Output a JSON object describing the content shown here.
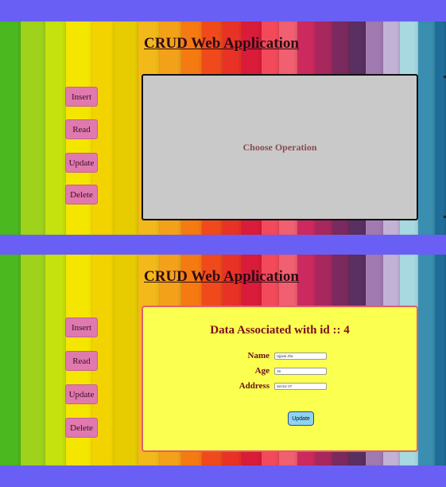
{
  "app_title": "CRUD Web Application",
  "menu": [
    "Insert",
    "Read",
    "Update",
    "Delete"
  ],
  "view1": {
    "message": "Choose Operation"
  },
  "view2": {
    "heading": "Data Associated with id :: 4",
    "fields": [
      {
        "label": "Name",
        "value": "Ujjwal Jha"
      },
      {
        "label": "Age",
        "value": "16"
      },
      {
        "label": "Address",
        "value": "Sector 07"
      }
    ],
    "update_label": "Update"
  },
  "colors": {
    "page_background": "#6a5ff5",
    "sidebar_button": "#e079ae",
    "choose_panel": "#c9c9c9",
    "data_panel": "#fbff4f",
    "update_button": "#8ed3f2",
    "stripes": [
      "#4bb81f",
      "#9fd21b",
      "#c5e20f",
      "#f5e600",
      "#f2d300",
      "#e6cc00",
      "#f3b91a",
      "#f4a11a",
      "#f57a12",
      "#f04a1c",
      "#e83226",
      "#d81c3a",
      "#f24a5a",
      "#f06070",
      "#cc2a5e",
      "#a8285e",
      "#7a2a5e",
      "#5a2f62",
      "#a07ab0",
      "#c2b3d6",
      "#a8d8e0",
      "#3a8fb0",
      "#1f6e99"
    ]
  }
}
